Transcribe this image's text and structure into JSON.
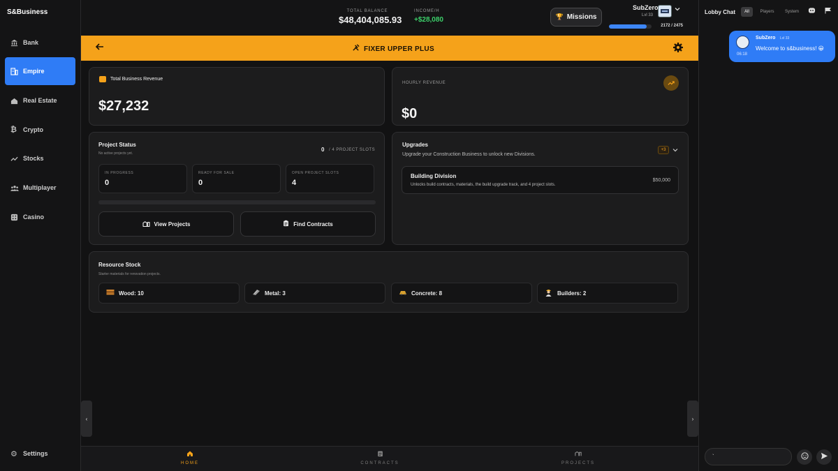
{
  "app": {
    "brand": "S&Business"
  },
  "sidebar": {
    "items": [
      {
        "label": "Bank",
        "icon": "bank-icon"
      },
      {
        "label": "Empire",
        "icon": "buildings-icon",
        "active": true
      },
      {
        "label": "Real Estate",
        "icon": "house-icon"
      },
      {
        "label": "Crypto",
        "icon": "bitcoin-icon"
      },
      {
        "label": "Stocks",
        "icon": "trend-icon"
      },
      {
        "label": "Multiplayer",
        "icon": "people-icon"
      },
      {
        "label": "Casino",
        "icon": "dice-icon"
      }
    ],
    "settings_label": "Settings"
  },
  "topbar": {
    "balance_label": "TOTAL BALANCE",
    "balance_value": "$48,404,085.93",
    "income_label": "INCOME/H",
    "income_value": "+$28,080",
    "missions_label": "Missions",
    "user_name": "SubZero",
    "user_level": "Lvl 33",
    "xp_text": "2172 / 2475",
    "xp_fraction": 0.8776
  },
  "header": {
    "title": "FIXER UPPER PLUS"
  },
  "revenue": {
    "title": "Total Business Revenue",
    "value": "$27,232",
    "hourly_label": "HOURLY REVENUE",
    "hourly_value": "$0"
  },
  "project_status": {
    "title": "Project Status",
    "subtitle": "No active projects yet.",
    "slots_count": "0",
    "slots_text": "/ 4 PROJECT SLOTS",
    "stats": [
      {
        "label": "IN PROGRESS",
        "value": "0"
      },
      {
        "label": "READY FOR SALE",
        "value": "0"
      },
      {
        "label": "OPEN PROJECT SLOTS",
        "value": "4"
      }
    ],
    "view_projects_label": "View Projects",
    "find_contracts_label": "Find Contracts"
  },
  "upgrades": {
    "title": "Upgrades",
    "subtitle": "Upgrade your Construction Business to unlock new Divisions.",
    "badge": "+3",
    "division_title": "Building Division",
    "division_desc": "Unlocks build contracts, materials, the build upgrade track, and 4 project slots.",
    "division_price": "$50,000"
  },
  "resources": {
    "title": "Resource Stock",
    "subtitle": "Starter materials for renovation projects.",
    "items": [
      {
        "label": "Wood: 10",
        "icon": "wood-icon"
      },
      {
        "label": "Metal: 3",
        "icon": "metal-icon"
      },
      {
        "label": "Concrete: 8",
        "icon": "concrete-icon"
      },
      {
        "label": "Builders: 2",
        "icon": "builder-icon"
      }
    ]
  },
  "bottom_nav": [
    {
      "label": "HOME",
      "icon": "home-icon",
      "active": true
    },
    {
      "label": "CONTRACTS",
      "icon": "clipboard-icon"
    },
    {
      "label": "PROJECTS",
      "icon": "building-icon"
    }
  ],
  "chat": {
    "title": "Lobby Chat",
    "tabs": [
      "All",
      "Players",
      "System"
    ],
    "message": {
      "user": "SubZero",
      "level": "Lvl 33",
      "time": "06:18",
      "text": "Welcome to s&business! 😀"
    },
    "input_value": "`"
  },
  "colors": {
    "accent_orange": "#f5a21a",
    "accent_blue": "#2f7cf6",
    "income_green": "#3ccf6a"
  }
}
